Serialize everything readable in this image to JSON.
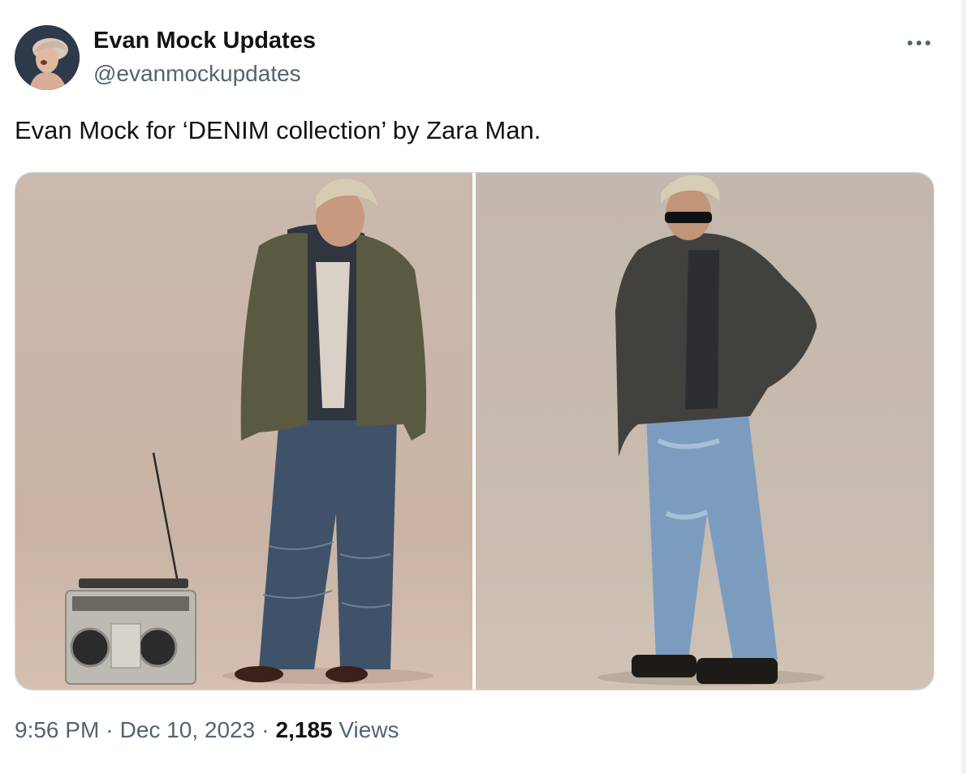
{
  "author": {
    "name": "Evan Mock Updates",
    "handle": "@evanmockupdates"
  },
  "tweet": {
    "text": "Evan Mock for ‘DENIM collection’ by Zara Man."
  },
  "meta": {
    "time": "9:56 PM",
    "separator": "·",
    "date": "Dec 10, 2023",
    "views_count": "2,185",
    "views_label": "Views"
  },
  "icons": {
    "more": "more-horizontal-icon"
  },
  "colors": {
    "text_primary": "#0f1419",
    "text_secondary": "#536471",
    "border": "#cfd9de"
  }
}
